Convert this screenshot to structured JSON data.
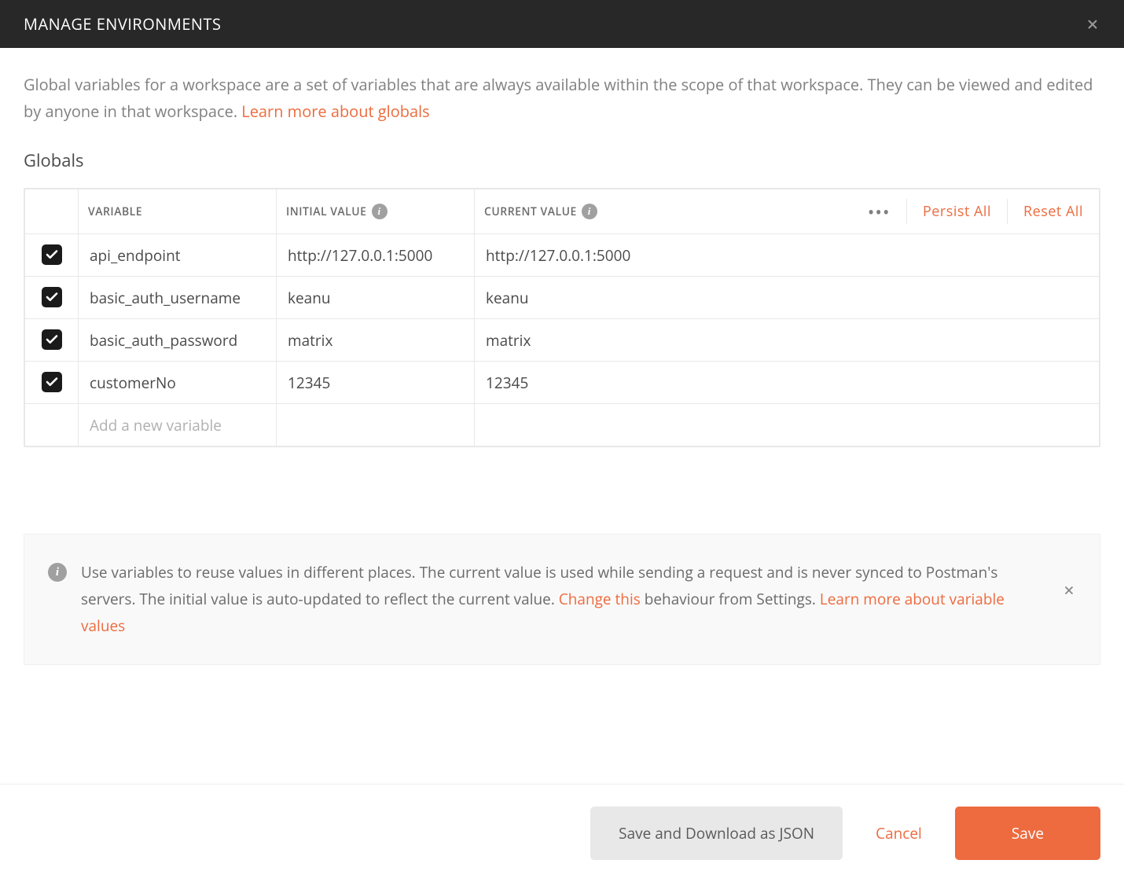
{
  "header": {
    "title": "MANAGE ENVIRONMENTS"
  },
  "description": {
    "text": "Global variables for a workspace are a set of variables that are always available within the scope of that workspace. They can be viewed and edited by anyone in that workspace. ",
    "link": "Learn more about globals"
  },
  "section_title": "Globals",
  "table": {
    "headers": {
      "variable": "VARIABLE",
      "initial": "INITIAL VALUE",
      "current": "CURRENT VALUE"
    },
    "actions": {
      "persist_all": "Persist All",
      "reset_all": "Reset All"
    },
    "rows": [
      {
        "checked": true,
        "variable": "api_endpoint",
        "initial": "http://127.0.0.1:5000",
        "current": "http://127.0.0.1:5000"
      },
      {
        "checked": true,
        "variable": "basic_auth_username",
        "initial": "keanu",
        "current": "keanu"
      },
      {
        "checked": true,
        "variable": "basic_auth_password",
        "initial": "matrix",
        "current": "matrix"
      },
      {
        "checked": true,
        "variable": "customerNo",
        "initial": "12345",
        "current": "12345"
      }
    ],
    "new_placeholder": "Add a new variable"
  },
  "banner": {
    "text1": "Use variables to reuse values in different places. The current value is used while sending a request and is never synced to Postman's servers. The initial value is auto-updated to reflect the current value. ",
    "link1": "Change this",
    "text2": " behaviour from Settings. ",
    "link2": "Learn more about variable values"
  },
  "footer": {
    "download": "Save and Download as JSON",
    "cancel": "Cancel",
    "save": "Save"
  }
}
